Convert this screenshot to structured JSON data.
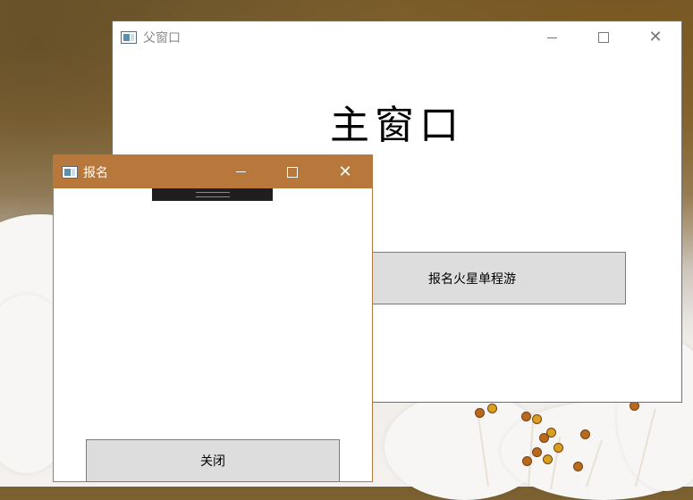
{
  "parent_window": {
    "title": "父窗口",
    "heading": "主窗口",
    "signup_button_label": "报名火星单程游",
    "icons": {
      "app": "window-app-icon",
      "minimize": "minimize-icon",
      "maximize": "maximize-icon",
      "close": "close-icon"
    }
  },
  "child_window": {
    "title": "报名",
    "close_button_label": "关闭",
    "titlebar_color": "#b9783b",
    "icons": {
      "app": "window-app-icon",
      "minimize": "minimize-icon",
      "maximize": "maximize-icon",
      "close": "close-icon"
    }
  }
}
